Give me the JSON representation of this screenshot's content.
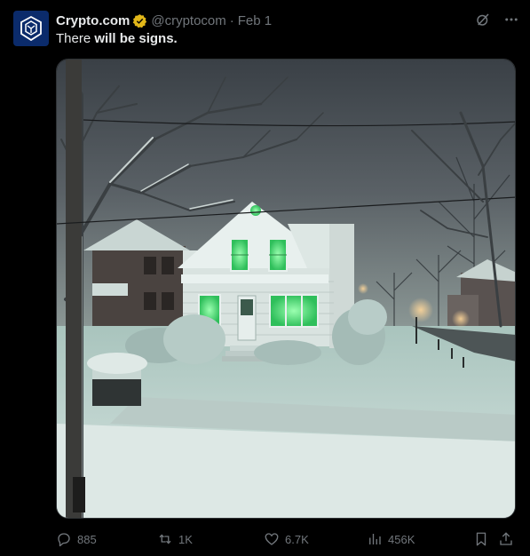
{
  "author": {
    "name": "Crypto.com",
    "handle": "@cryptocom",
    "separator": "·",
    "date": "Feb 1"
  },
  "tweet": {
    "text_plain": "There ",
    "text_bold": "will be signs."
  },
  "metrics": {
    "replies": "885",
    "reposts": "1K",
    "likes": "6.7K",
    "views": "456K"
  },
  "colors": {
    "background": "#000000",
    "text": "#e7e9ea",
    "muted": "#71767b",
    "verified": "#e2b719",
    "avatar_bg": "#0b2b6b",
    "window_glow": "#4df07a"
  },
  "icons": {
    "avatar": "crypto-com-lion-logo",
    "verified": "verified-badge-icon",
    "grok": "grok-icon",
    "more": "more-dots-icon",
    "reply": "reply-icon",
    "repost": "repost-icon",
    "like": "heart-icon",
    "views": "views-icon",
    "bookmark": "bookmark-icon",
    "share": "share-icon"
  }
}
